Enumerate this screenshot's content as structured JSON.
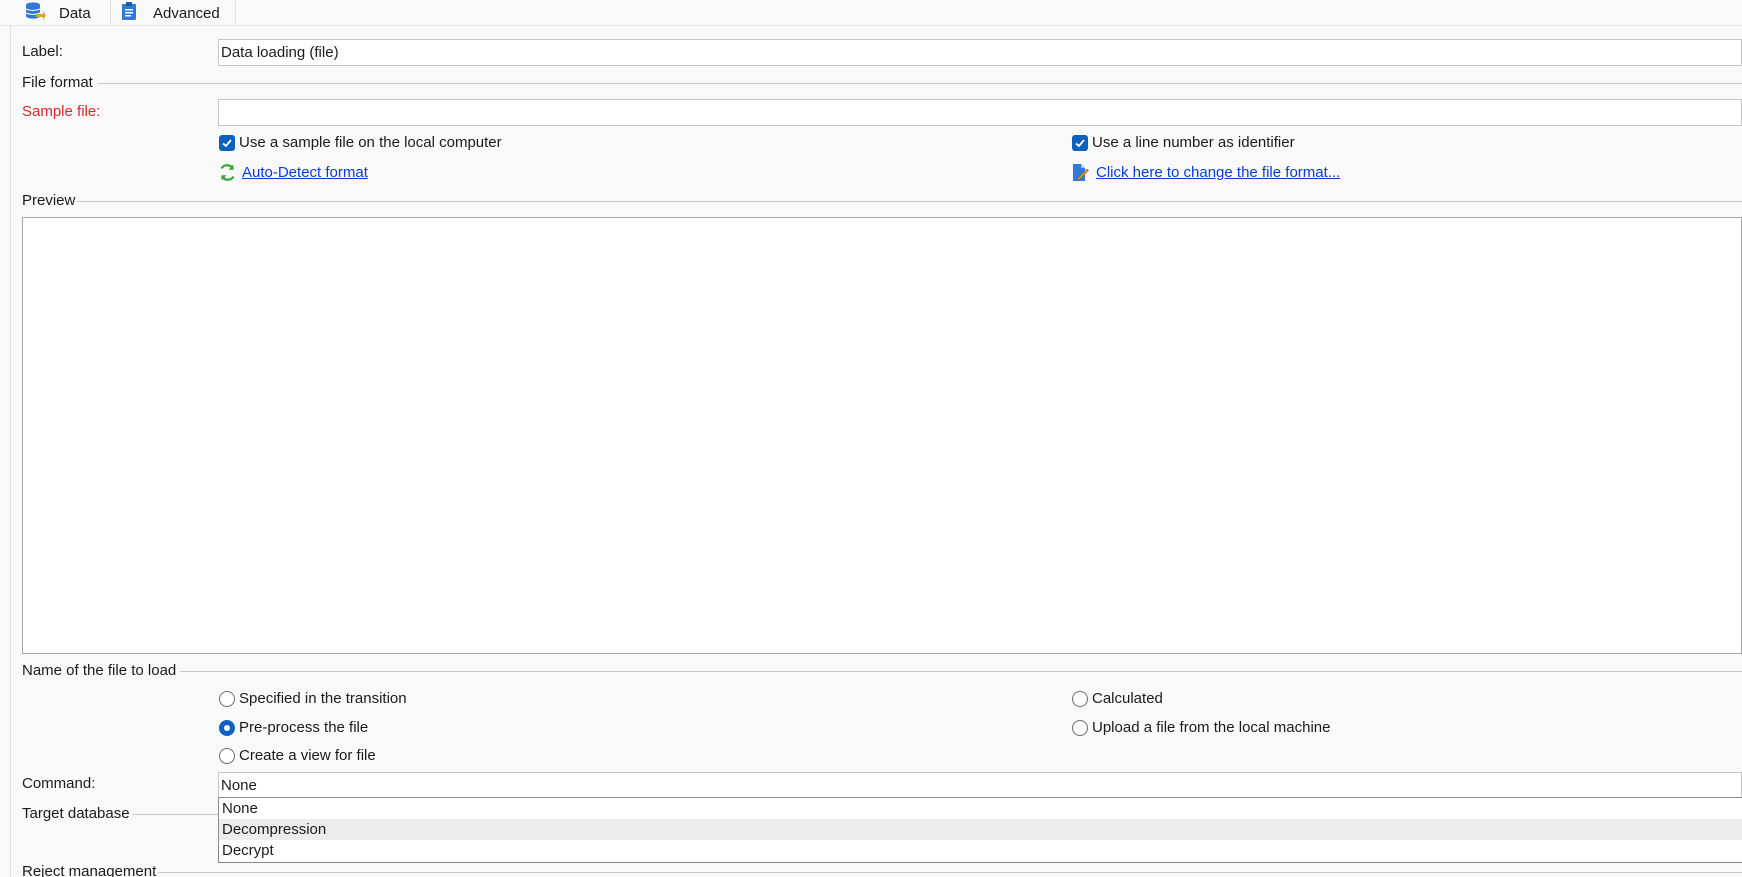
{
  "tabs": [
    {
      "label": "Data",
      "icon": "database-icon"
    },
    {
      "label": "Advanced",
      "icon": "clipboard-icon"
    }
  ],
  "form": {
    "label_caption": "Label:",
    "label_value": "Data loading (file)",
    "sample_file_caption": "Sample file:",
    "sample_file_value": ""
  },
  "sections": {
    "file_format": "File format",
    "preview": "Preview",
    "file_to_load": "Name of the file to load",
    "target_database": "Target database",
    "reject_management": "Reject management"
  },
  "checkboxes": {
    "use_sample_local": {
      "label": "Use a sample file on the local computer",
      "checked": true
    },
    "line_number_id": {
      "label": "Use a line number as identifier",
      "checked": true
    }
  },
  "links": {
    "auto_detect": "Auto-Detect format",
    "change_format": "Click here to change the file format..."
  },
  "file_to_load_options": [
    {
      "label": "Specified in the transition",
      "selected": false
    },
    {
      "label": "Calculated",
      "selected": false
    },
    {
      "label": "Pre-process the file",
      "selected": true
    },
    {
      "label": "Upload a file from the local machine",
      "selected": false
    },
    {
      "label": "Create a view for file",
      "selected": false
    }
  ],
  "command": {
    "caption": "Command:",
    "value": "None",
    "options": [
      "None",
      "Decompression",
      "Decrypt"
    ],
    "highlighted": "Decompression"
  },
  "colors": {
    "accent": "#0d62c0",
    "link": "#0a3bd6",
    "required": "#d6282c",
    "refresh_icon": "#3aa23a"
  }
}
